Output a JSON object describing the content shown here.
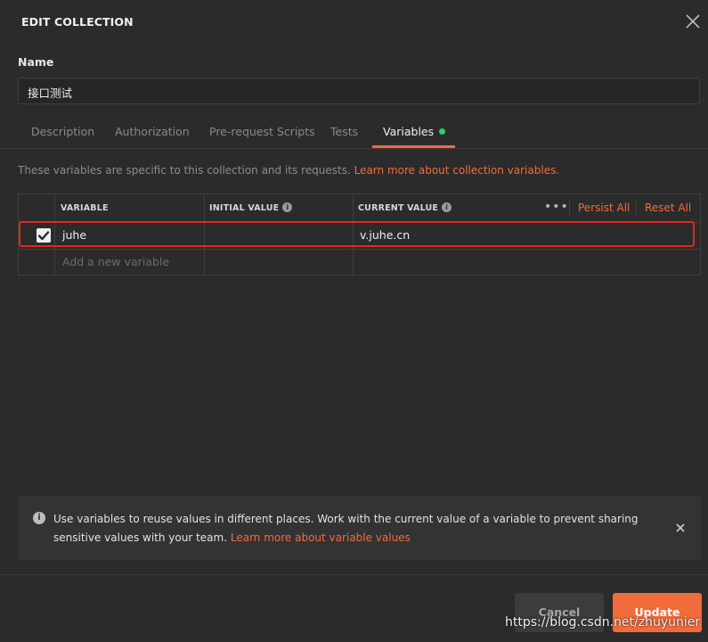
{
  "dialog": {
    "title": "EDIT COLLECTION"
  },
  "name_field": {
    "label": "Name",
    "value": "接口测试"
  },
  "tabs": [
    {
      "label": "Description",
      "active": false
    },
    {
      "label": "Authorization",
      "active": false
    },
    {
      "label": "Pre-request Scripts",
      "active": false
    },
    {
      "label": "Tests",
      "active": false
    },
    {
      "label": "Variables",
      "active": true
    }
  ],
  "variables_section": {
    "description": "These variables are specific to this collection and its requests.",
    "learn_more_link": "Learn more about collection variables."
  },
  "table": {
    "headers": {
      "variable": "VARIABLE",
      "initial_value": "INITIAL VALUE",
      "current_value": "CURRENT VALUE"
    },
    "actions": {
      "more": "•••",
      "persist_all": "Persist All",
      "reset_all": "Reset All"
    },
    "rows": [
      {
        "checked": true,
        "variable": "juhe",
        "initial_value": "",
        "current_value": "v.juhe.cn"
      }
    ],
    "new_row_placeholder": "Add a new variable"
  },
  "notice": {
    "text": "Use variables to reuse values in different places. Work with the current value of a variable to prevent sharing sensitive values with your team.",
    "link": "Learn more about variable values"
  },
  "footer": {
    "cancel_label": "Cancel",
    "update_label": "Update"
  },
  "watermark": "https://blog.csdn.net/zhuyunier",
  "colors": {
    "accent": "#f26b3a",
    "status_dot": "#2ecc71",
    "highlight_box": "#e0281f"
  },
  "icons": {
    "close": "close-icon",
    "info": "info-icon",
    "check": "check-icon"
  }
}
